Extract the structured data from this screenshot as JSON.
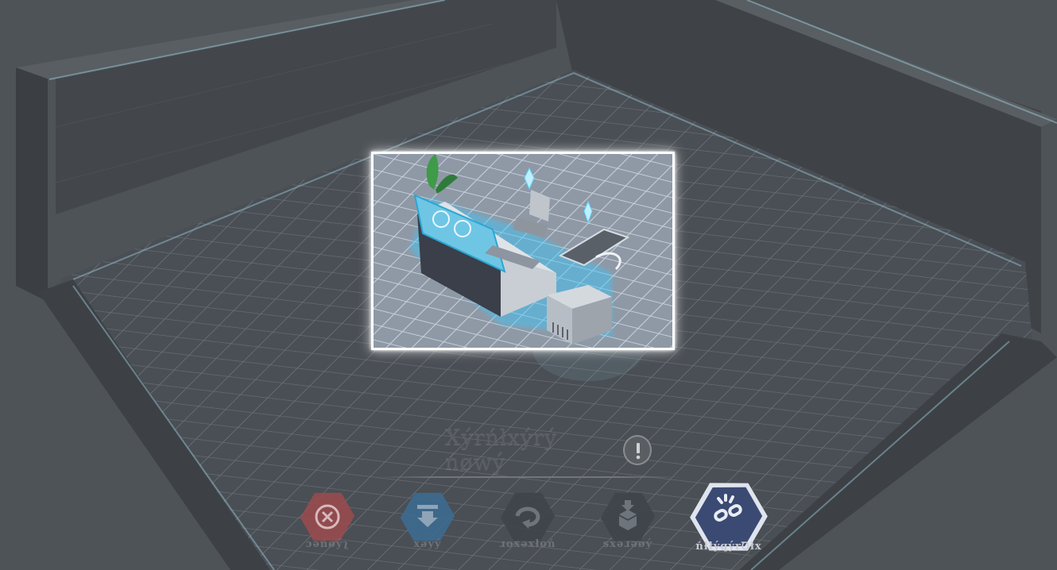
{
  "title": "Xýrńłxýrý ńøwý",
  "actions": [
    {
      "id": "cancel",
      "label": "ɔəńøýʅ",
      "icon": "close-icon",
      "color": "#b04c4c"
    },
    {
      "id": "store",
      "label": "xəyý",
      "icon": "store-icon",
      "color": "#3d6a90"
    },
    {
      "id": "rotate",
      "label": "ɹoxəxłoń",
      "icon": "rotate-icon",
      "color": "#3f444b"
    },
    {
      "id": "pack",
      "label": "sxəɹəøý",
      "icon": "pack-icon",
      "color": "#3f444b"
    },
    {
      "id": "detach",
      "label": "ńłłýqýrꝹłx",
      "icon": "detach-icon",
      "color": "#3b4a73"
    }
  ],
  "colors": {
    "glow": "#3fd4ff",
    "highlight": "#ffffff",
    "floor": "#4b5056"
  }
}
